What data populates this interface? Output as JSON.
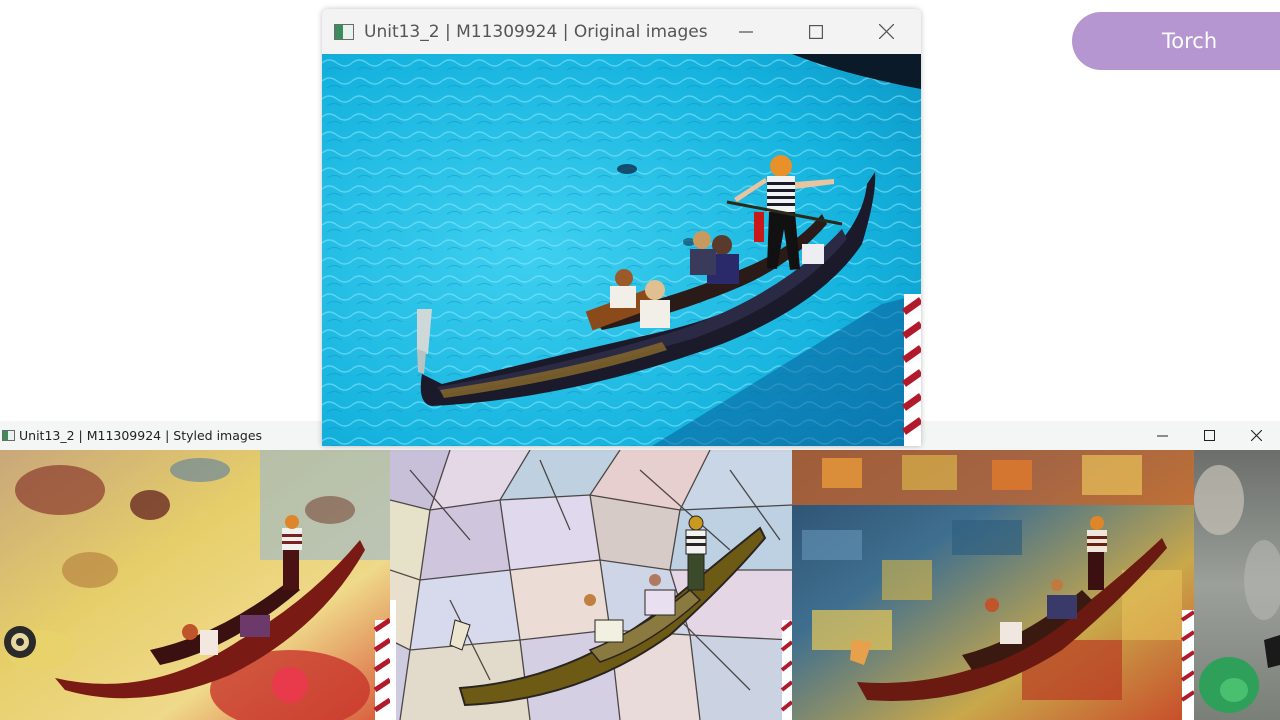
{
  "original_window": {
    "title": "Unit13_2 | M11309924 | Original images",
    "minimize_glyph": "—",
    "maximize_glyph": "☐",
    "close_glyph": "✕",
    "image_alt": "Gondola with gondolier and passengers on turquoise water"
  },
  "styled_window": {
    "title": "Unit13_2 | M11309924 | Styled images",
    "minimize_glyph": "—",
    "maximize_glyph": "☐",
    "close_glyph": "✕",
    "images": [
      {
        "style": "oil-abstract-red-yellow"
      },
      {
        "style": "stained-glass-mosaic"
      },
      {
        "style": "impressionist-autumn"
      },
      {
        "style": "grey-green-partial"
      }
    ]
  },
  "torch_button": {
    "label": "Torch"
  },
  "colors": {
    "torch": "#b596d0",
    "water": "#19b8df",
    "titlebar": "#f3f3f3"
  }
}
